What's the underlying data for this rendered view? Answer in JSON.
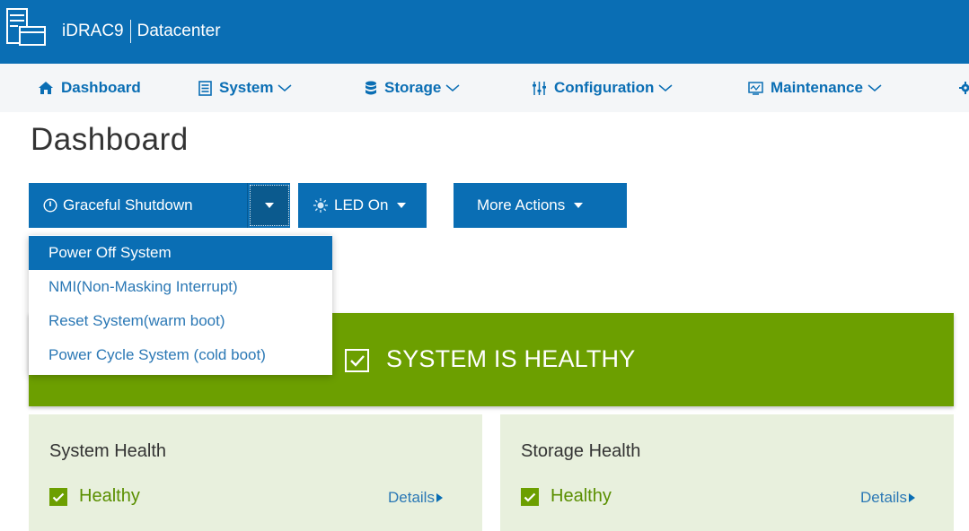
{
  "header": {
    "brand": "iDRAC9",
    "edition": "Datacenter",
    "logo_icon": "server-logo-icon",
    "background": "#0a6eb4"
  },
  "nav": {
    "items": [
      {
        "label": "Dashboard",
        "icon": "home-icon",
        "has_menu": false
      },
      {
        "label": "System",
        "icon": "server-icon",
        "has_menu": true
      },
      {
        "label": "Storage",
        "icon": "database-icon",
        "has_menu": true
      },
      {
        "label": "Configuration",
        "icon": "sliders-icon",
        "has_menu": true
      },
      {
        "label": "Maintenance",
        "icon": "monitor-icon",
        "has_menu": true
      }
    ],
    "overflow_icon": "gear-icon"
  },
  "page": {
    "title": "Dashboard"
  },
  "actions": {
    "shutdown_label": "Graceful Shutdown",
    "shutdown_icon": "power-icon",
    "led_label": "LED On",
    "led_icon": "sun-icon",
    "more_label": "More Actions"
  },
  "power_menu": {
    "items": [
      {
        "label": "Power Off System",
        "active": true
      },
      {
        "label": "NMI(Non-Masking Interrupt)",
        "active": false
      },
      {
        "label": "Reset System(warm boot)",
        "active": false
      },
      {
        "label": "Power Cycle System (cold boot)",
        "active": false
      }
    ]
  },
  "health": {
    "banner_text": "SYSTEM IS HEALTHY",
    "color": "#6c9f00"
  },
  "cards": [
    {
      "title": "System Health",
      "status": "Healthy",
      "details_label": "Details"
    },
    {
      "title": "Storage Health",
      "status": "Healthy",
      "details_label": "Details"
    }
  ]
}
